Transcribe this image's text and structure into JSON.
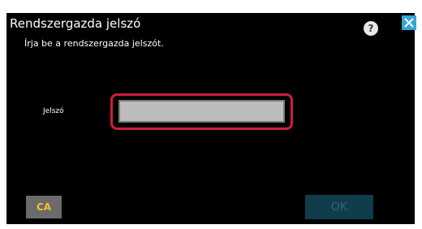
{
  "dialog": {
    "title": "Rendszergazda jelszó",
    "instruction": "Írja be a rendszergazda jelszót.",
    "help_label": "?",
    "close_icon": "close-icon"
  },
  "form": {
    "password_label": "Jelszó",
    "password_value": "",
    "highlight_color": "#cc1f3a"
  },
  "buttons": {
    "ca_label": "CA",
    "ok_label": "OK",
    "accent_color": "#35a7d6",
    "ca_text_color": "#f1c232"
  }
}
